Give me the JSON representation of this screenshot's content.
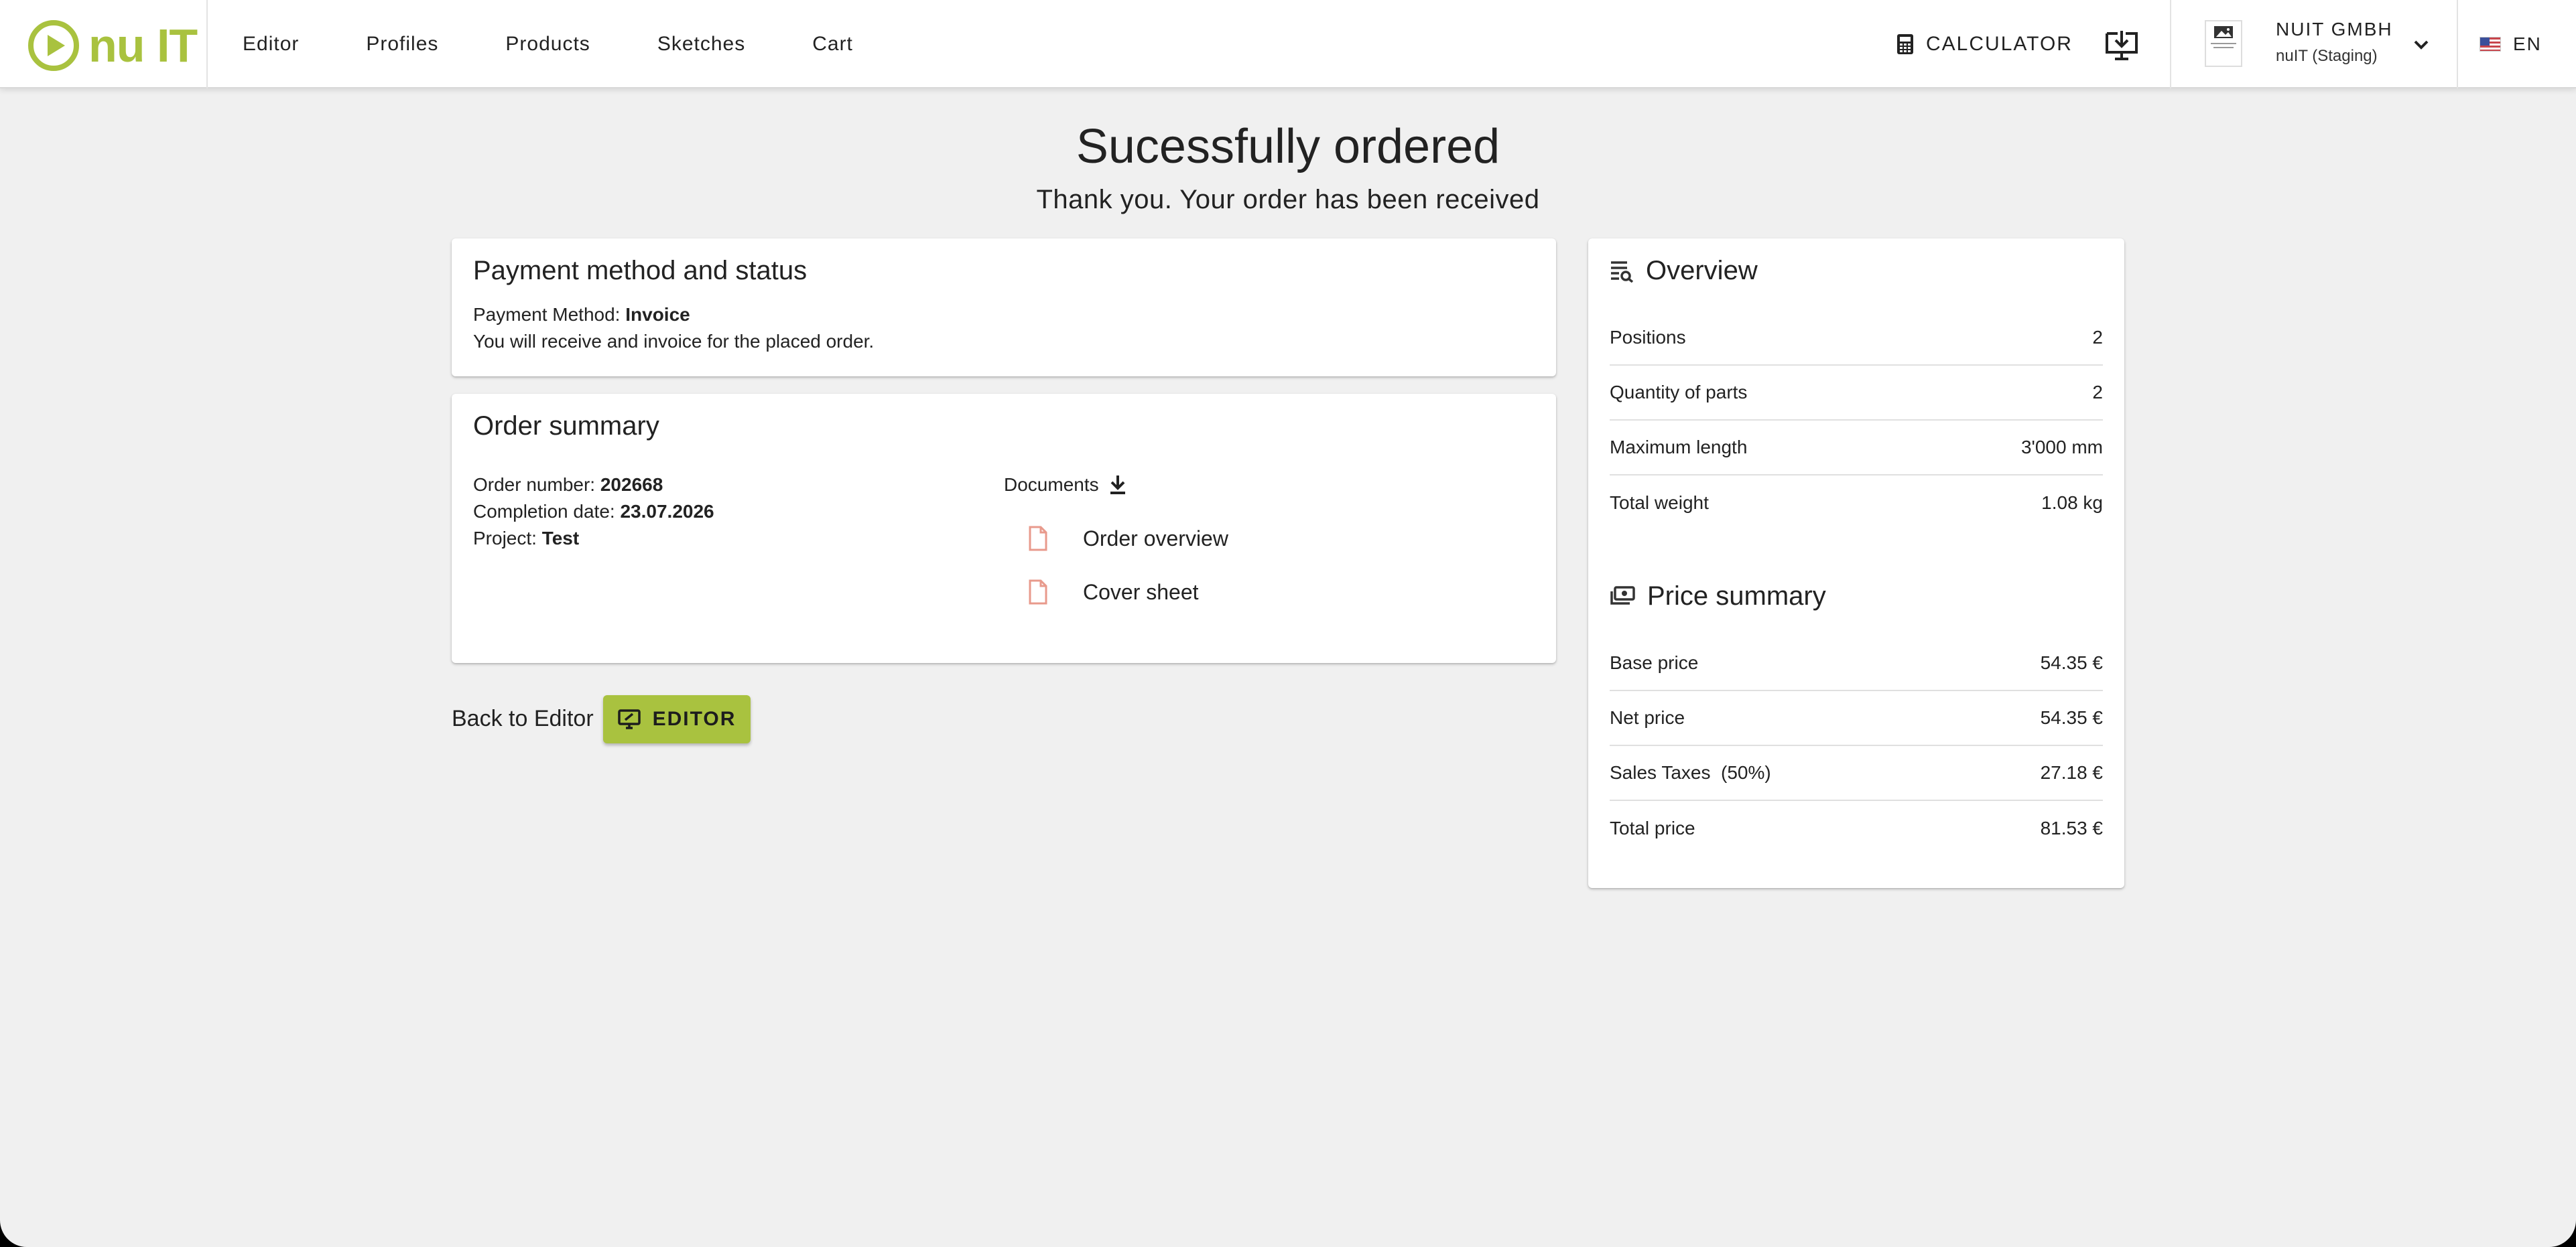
{
  "header": {
    "logo_text": "nu IT",
    "nav": [
      "Editor",
      "Profiles",
      "Products",
      "Sketches",
      "Cart"
    ],
    "calculator_label": "CALCULATOR",
    "company_name": "NUIT GMBH",
    "company_sub": "nuIT (Staging)",
    "language": "EN"
  },
  "page": {
    "title": "Sucessfully ordered",
    "subtitle": "Thank you. Your order has been received"
  },
  "payment": {
    "title": "Payment method and status",
    "method_label": "Payment Method: ",
    "method_value": "Invoice",
    "note": "You will receive and invoice for the placed order."
  },
  "order_summary": {
    "title": "Order summary",
    "order_number_label": "Order number: ",
    "order_number": "202668",
    "completion_label": "Completion date: ",
    "completion_date": "23.07.2026",
    "project_label": "Project: ",
    "project": "Test",
    "documents_label": "Documents",
    "documents": [
      "Order overview",
      "Cover sheet"
    ]
  },
  "actions": {
    "back_label": "Back to Editor",
    "editor_button": "EDITOR"
  },
  "overview": {
    "title": "Overview",
    "rows": [
      {
        "label": "Positions",
        "value": "2"
      },
      {
        "label": "Quantity of parts",
        "value": "2"
      },
      {
        "label": "Maximum length",
        "value": "3'000 mm"
      },
      {
        "label": "Total weight",
        "value": "1.08 kg"
      }
    ]
  },
  "price_summary": {
    "title": "Price summary",
    "rows": [
      {
        "label": "Base price",
        "value": "54.35 €"
      },
      {
        "label": "Net price",
        "value": "54.35 €"
      },
      {
        "label": "Sales Taxes  (50%)",
        "value": "27.18 €"
      },
      {
        "label": "Total price",
        "value": "81.53 €"
      }
    ]
  },
  "colors": {
    "brand": "#a9c23f",
    "doc_icon": "#e89a8c",
    "background": "#f0f0f0"
  }
}
